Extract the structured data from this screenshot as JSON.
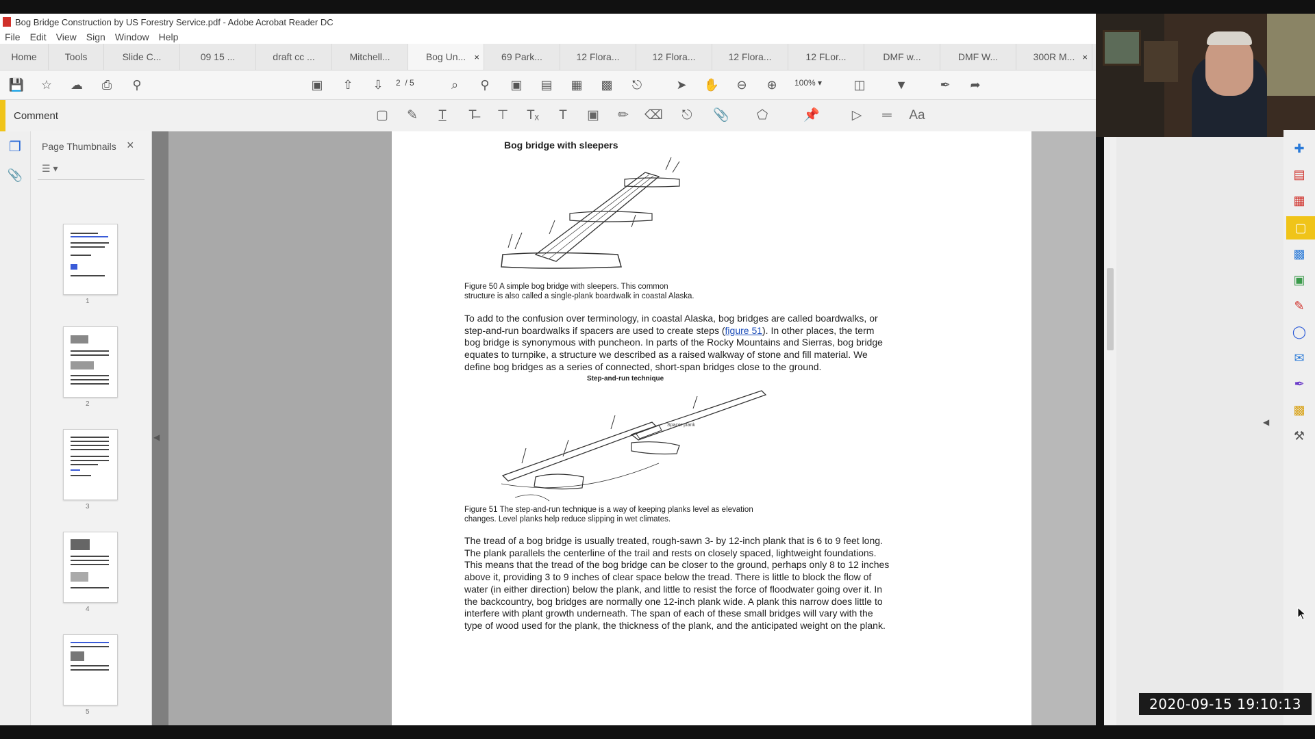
{
  "window": {
    "title": "Bog Bridge Construction by US Forestry Service.pdf - Adobe Acrobat Reader DC"
  },
  "menu": [
    "File",
    "Edit",
    "View",
    "Sign",
    "Window",
    "Help"
  ],
  "tabs": [
    {
      "label": "Home"
    },
    {
      "label": "Tools"
    },
    {
      "label": "Slide C..."
    },
    {
      "label": "09 15 ..."
    },
    {
      "label": "draft cc ..."
    },
    {
      "label": "Mitchell..."
    },
    {
      "label": "Bog Un...",
      "close": "×"
    },
    {
      "label": "69 Park..."
    },
    {
      "label": "12 Flora..."
    },
    {
      "label": "12 Flora..."
    },
    {
      "label": "12 Flora..."
    },
    {
      "label": "12 FLor..."
    },
    {
      "label": "DMF w..."
    },
    {
      "label": "DMF W..."
    },
    {
      "label": "300R M...",
      "close": "×"
    }
  ],
  "toolbar": {
    "page_current": "2",
    "page_total": "/ 5",
    "zoom": "100%"
  },
  "comment_bar": {
    "label": "Comment"
  },
  "thumbnails": {
    "title": "Page Thumbnails",
    "close": "×",
    "pages": [
      "1",
      "2",
      "3",
      "4",
      "5"
    ]
  },
  "document": {
    "fig50_title": "Bog bridge with sleepers",
    "fig50_caption_1": "Figure 50  A simple bog bridge with sleepers. This common",
    "fig50_caption_2": "structure is also called a single-plank boardwalk in coastal Alaska.",
    "para1_a": "To add to the confusion over terminology, in coastal Alaska, bog bridges are called boardwalks, or",
    "para1_b": "step-and-run boardwalks if spacers are used to create steps (",
    "para1_link": "figure 51",
    "para1_c": "). In other places, the term",
    "para1_d": "bog bridge is synonymous with puncheon. In parts of the Rocky Mountains and Sierras, bog bridge",
    "para1_e": "equates to turnpike, a structure we described as a raised walkway of stone and fill material. We",
    "para1_f": "define bog bridges as a series of connected, short-span bridges close to the ground.",
    "fig51_title": "Step-and-run technique",
    "fig51_label": "Spacer plank",
    "fig51_caption_1": "Figure 51  The step-and-run technique is a way of keeping planks level as elevation",
    "fig51_caption_2": "changes. Level planks help reduce slipping in wet climates.",
    "para2": [
      "The tread of a bog bridge is usually treated, rough-sawn 3- by 12-inch plank that is 6 to 9 feet long.",
      "The plank parallels the centerline of the trail and rests on closely spaced, lightweight foundations.",
      "This means that the tread of the bog bridge can be closer to the ground, perhaps only 8 to 12 inches",
      "above it, providing 3 to 9 inches of clear space below the tread. There is little to block the flow of",
      "water (in either direction) below the plank, and little to resist the force of floodwater going over it. In",
      "the backcountry, bog bridges are normally one 12-inch plank wide. A plank this narrow does little to",
      "interfere with plant growth underneath. The span of each of these small bridges will vary with the",
      "type of wood used for the plank, the thickness of the plank, and the anticipated weight on the plank."
    ]
  },
  "overlay": {
    "timestamp": "2020-09-15  19:10:13"
  },
  "colors": {
    "accent": "#f0c419",
    "pdf_red": "#d0302a",
    "link": "#1a4bb8"
  }
}
